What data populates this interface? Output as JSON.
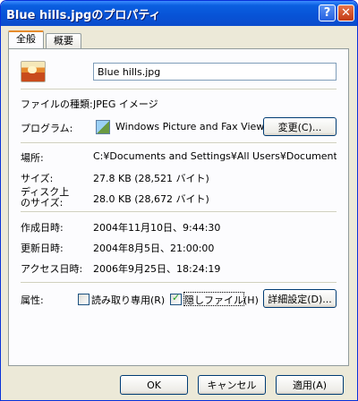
{
  "window": {
    "title": "Blue hills.jpgのプロパティ",
    "help_glyph": "?",
    "close_glyph": "✕"
  },
  "tabs": [
    {
      "label": "全般",
      "active": true
    },
    {
      "label": "概要",
      "active": false
    }
  ],
  "file_name": "Blue hills.jpg",
  "file_type": {
    "label": "ファイルの種類:",
    "value": "JPEG イメージ"
  },
  "program": {
    "label": "プログラム:",
    "value": "Windows Picture and Fax Viewer",
    "change_button": "変更(C)..."
  },
  "location": {
    "label": "場所:",
    "value": "C:¥Documents and Settings¥All Users¥Documents¥My F"
  },
  "size": {
    "label": "サイズ:",
    "value": "27.8 KB (28,521 バイト)"
  },
  "disk_size": {
    "label_line1": "ディスク上",
    "label_line2": "のサイズ:",
    "value": "28.0 KB (28,672 バイト)"
  },
  "created": {
    "label": "作成日時:",
    "value": "2004年11月10日、9:44:30"
  },
  "modified": {
    "label": "更新日時:",
    "value": "2004年8月5日、21:00:00"
  },
  "accessed": {
    "label": "アクセス日時:",
    "value": "2006年9月25日、18:24:19"
  },
  "attributes": {
    "label": "属性:",
    "readonly": {
      "label": "読み取り専用(R)",
      "checked": false
    },
    "hidden": {
      "label": "隠しファイル(H)",
      "checked": true
    },
    "advanced_button": "詳細設定(D)..."
  },
  "footer": {
    "ok": "OK",
    "cancel": "キャンセル",
    "apply": "適用(A)"
  },
  "colors": {
    "titlebar": "#0853d6",
    "face": "#ece9d8",
    "panel": "#fcfcfe",
    "button_border": "#003c74"
  }
}
